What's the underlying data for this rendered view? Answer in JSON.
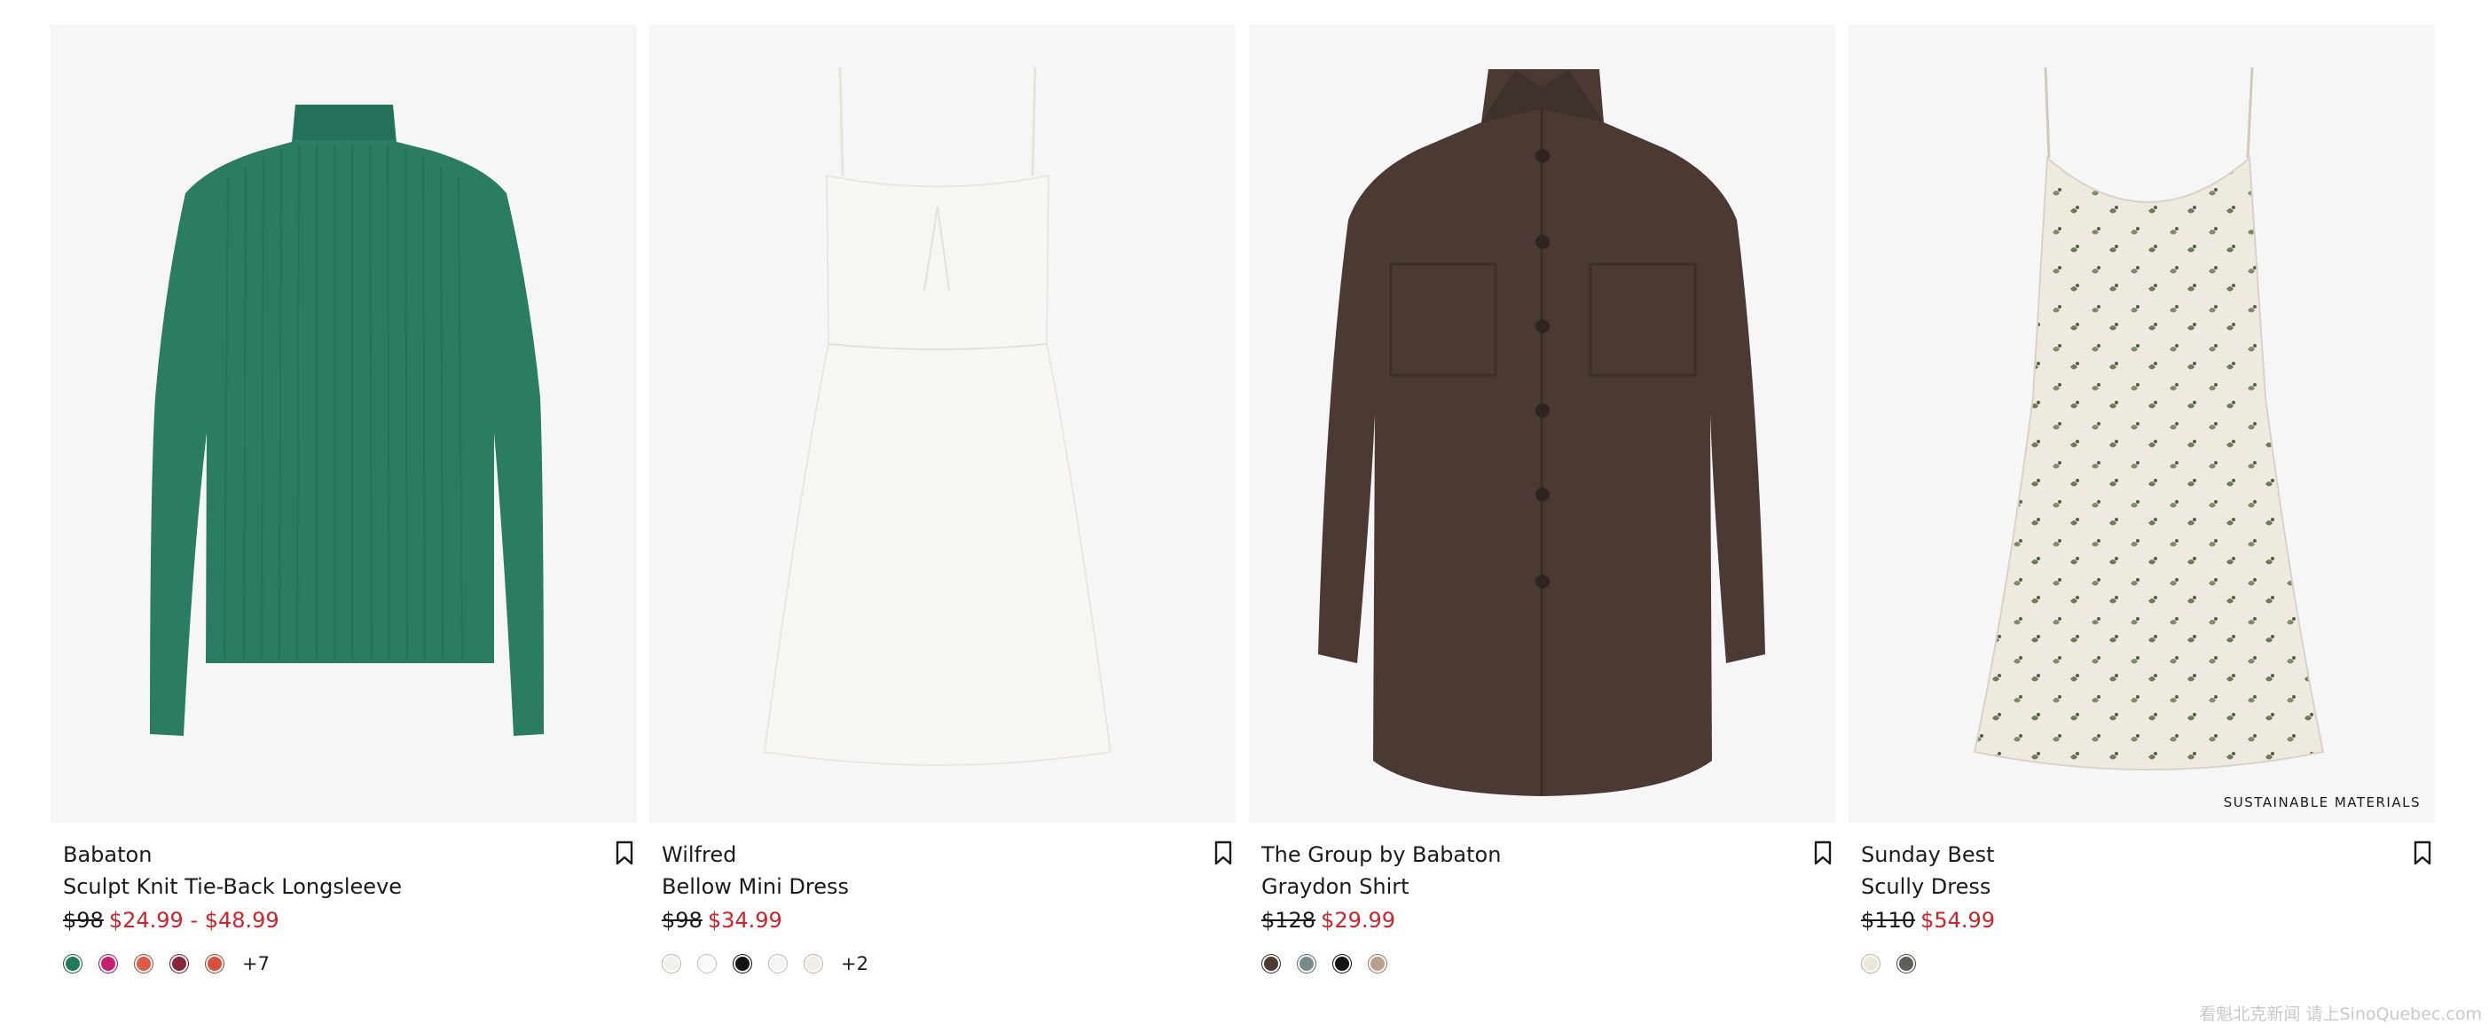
{
  "products": [
    {
      "brand": "Babaton",
      "name": "Sculpt Knit Tie-Back Longsleeve",
      "original_price": "$98",
      "sale_price": "$24.99 - $48.99",
      "badge": "",
      "swatches": [
        "#1f7a5c",
        "#c81e6e",
        "#dd5a44",
        "#8a2438",
        "#d9503a"
      ],
      "more_colors": "+7",
      "image_icon": "green-ribbed-longsleeve-top",
      "garment_color": "#2a7d63"
    },
    {
      "brand": "Wilfred",
      "name": "Bellow Mini Dress",
      "original_price": "$98",
      "sale_price": "$34.99",
      "badge": "",
      "swatches": [
        "#f2f0ea",
        "#fafafa",
        "#141414",
        "#f4f4f2",
        "#f1ede4"
      ],
      "more_colors": "+2",
      "image_icon": "white-mini-dress",
      "garment_color": "#f7f6f2"
    },
    {
      "brand": "The Group by Babaton",
      "name": "Graydon Shirt",
      "original_price": "$128",
      "sale_price": "$29.99",
      "badge": "",
      "swatches": [
        "#4b3b33",
        "#7a8a88",
        "#141414",
        "#b9a08a"
      ],
      "more_colors": "",
      "image_icon": "brown-corduroy-shirt",
      "garment_color": "#4a3a33"
    },
    {
      "brand": "Sunday Best",
      "name": "Scully Dress",
      "original_price": "$110",
      "sale_price": "$54.99",
      "badge": "SUSTAINABLE MATERIALS",
      "swatches": [
        "#ece6d6",
        "#5c6058"
      ],
      "more_colors": "",
      "image_icon": "floral-slip-dress",
      "garment_color": "#eeeae0"
    }
  ],
  "watermark": "看魁北克新闻 请上SinoQuebec.com"
}
